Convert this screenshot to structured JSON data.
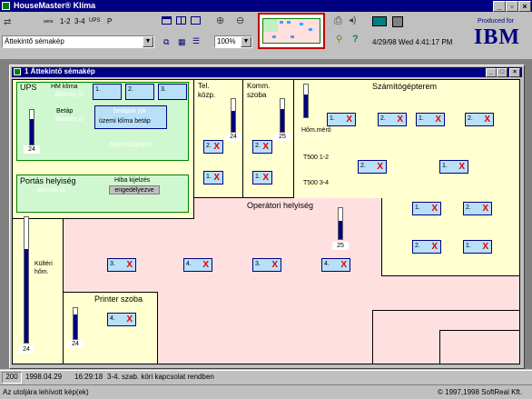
{
  "app": {
    "title": "HouseMaster® Klíma"
  },
  "toolbar": {
    "btn_all": "sens",
    "btn_12": "1-2",
    "btn_34": "3-4",
    "btn_ups": "UPS",
    "btn_p": "P",
    "view_select": "Áttekintő sémakép",
    "zoom_select": "100%",
    "datetime": "4/29/98 Wed 4:41:17 PM",
    "produced_for": "Produced for",
    "ibm": "IBM"
  },
  "child": {
    "title": "1  Áttekintő sémakép"
  },
  "rooms": {
    "ups": "UPS",
    "hm_klima": "HM klíma",
    "allomas_jo": "állomás jó",
    "betap": "Betáp",
    "betapok_jok": "betápok jók",
    "uzemi_klima_betap": "üzemi klíma betáp",
    "nincs_tuzjelzes": "Nincs tűzjelzés",
    "portas": "Portás helyiség",
    "hiba_kijelzes": "Hiba kijelzés",
    "engedelyezve": "engedélyezve",
    "tel_kozp": "Tel.\nközp.",
    "komm_szoba": "Komm.\nszoba",
    "szamitogepterem": "Számítógépterem",
    "homero": "Hőm.mérő",
    "t500_12": "T500 1-2",
    "t500_34": "T500 3-4",
    "operatori": "Operátori helyiség",
    "kulteri": "Kültéri\nhőm.",
    "printer": "Printer szoba"
  },
  "thermometers": {
    "ups": {
      "value": "24",
      "level": 0.75
    },
    "tel": {
      "value": "24",
      "level": 0.65
    },
    "komm": {
      "value": "25",
      "level": 0.7
    },
    "szam": {
      "value": "",
      "level": 0.7
    },
    "oper": {
      "value": "25",
      "level": 0.6
    },
    "kulteri": {
      "value": "24",
      "level": 0.75
    },
    "printer": {
      "value": "24",
      "level": 0.8
    }
  },
  "sensors": {
    "ups1": "1.",
    "ups2": "2.",
    "ups3": "3.",
    "tel2": "2.",
    "tel1": "1.",
    "komm2": "2.",
    "komm1": "1.",
    "sz1": "1.",
    "sz2": "2.",
    "sz3": "1.",
    "sz4": "2.",
    "sz5": "2.",
    "sz6": "1.",
    "sz7": "1.",
    "sz8": "2.",
    "sz9": "2.",
    "sz10": "1.",
    "op3": "3.",
    "op4": "4.",
    "op3b": "3.",
    "op4b": "4.",
    "pr4": "4.",
    "x_mark": "X"
  },
  "status": {
    "code": "200",
    "date": "1998.04.29",
    "time": "16:29:18",
    "message": "3-4. szab. köri kapcsolat rendben",
    "bottom_left": "Az utoljára lehívott kép(ek)",
    "copyright": "© 1997,1998 SoftReal Kft."
  }
}
